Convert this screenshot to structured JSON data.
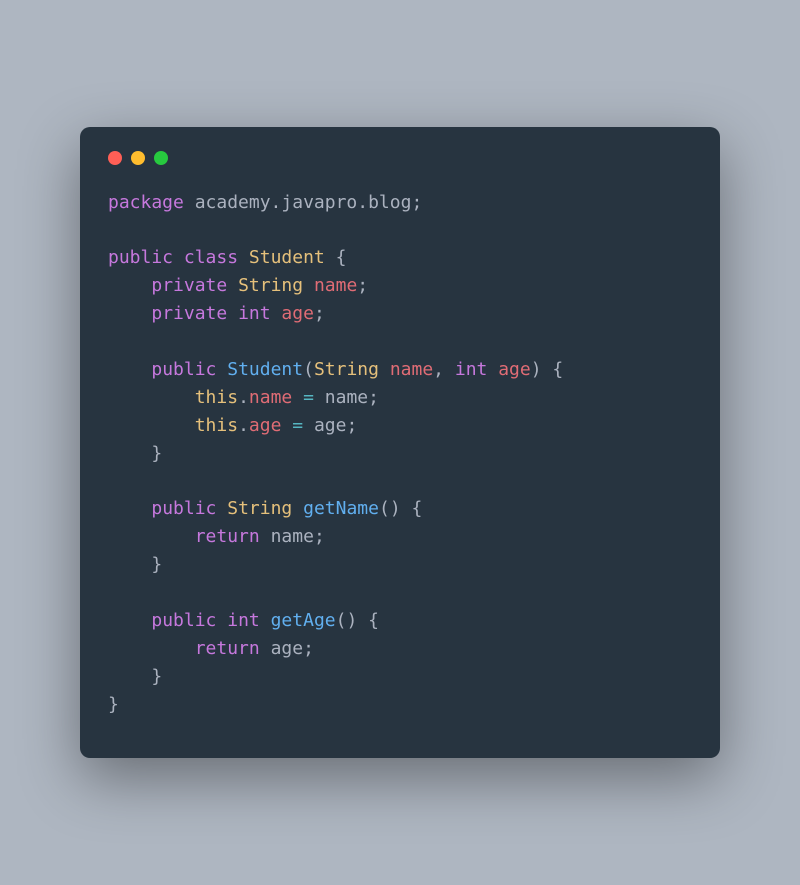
{
  "window": {
    "dot_colors": {
      "red": "#ff5f56",
      "yellow": "#ffbd2e",
      "green": "#27c93f"
    }
  },
  "code": {
    "tokens": [
      [
        [
          "kw",
          "package"
        ],
        [
          "plain",
          " "
        ],
        [
          "pkg",
          "academy.javapro.blog"
        ],
        [
          "punct",
          ";"
        ]
      ],
      [
        [
          "plain",
          ""
        ]
      ],
      [
        [
          "kw",
          "public"
        ],
        [
          "plain",
          " "
        ],
        [
          "kw",
          "class"
        ],
        [
          "plain",
          " "
        ],
        [
          "type",
          "Student"
        ],
        [
          "plain",
          " "
        ],
        [
          "punct",
          "{"
        ]
      ],
      [
        [
          "plain",
          "    "
        ],
        [
          "kw",
          "private"
        ],
        [
          "plain",
          " "
        ],
        [
          "type",
          "String"
        ],
        [
          "plain",
          " "
        ],
        [
          "ident",
          "name"
        ],
        [
          "punct",
          ";"
        ]
      ],
      [
        [
          "plain",
          "    "
        ],
        [
          "kw",
          "private"
        ],
        [
          "plain",
          " "
        ],
        [
          "kw",
          "int"
        ],
        [
          "plain",
          " "
        ],
        [
          "ident",
          "age"
        ],
        [
          "punct",
          ";"
        ]
      ],
      [
        [
          "plain",
          ""
        ]
      ],
      [
        [
          "plain",
          "    "
        ],
        [
          "kw",
          "public"
        ],
        [
          "plain",
          " "
        ],
        [
          "fn",
          "Student"
        ],
        [
          "punct",
          "("
        ],
        [
          "type",
          "String"
        ],
        [
          "plain",
          " "
        ],
        [
          "ident",
          "name"
        ],
        [
          "punct",
          ","
        ],
        [
          "plain",
          " "
        ],
        [
          "kw",
          "int"
        ],
        [
          "plain",
          " "
        ],
        [
          "ident",
          "age"
        ],
        [
          "punct",
          ")"
        ],
        [
          "plain",
          " "
        ],
        [
          "punct",
          "{"
        ]
      ],
      [
        [
          "plain",
          "        "
        ],
        [
          "thiskw",
          "this"
        ],
        [
          "punct",
          "."
        ],
        [
          "ident",
          "name"
        ],
        [
          "plain",
          " "
        ],
        [
          "op",
          "="
        ],
        [
          "plain",
          " "
        ],
        [
          "plain",
          "name"
        ],
        [
          "punct",
          ";"
        ]
      ],
      [
        [
          "plain",
          "        "
        ],
        [
          "thiskw",
          "this"
        ],
        [
          "punct",
          "."
        ],
        [
          "ident",
          "age"
        ],
        [
          "plain",
          " "
        ],
        [
          "op",
          "="
        ],
        [
          "plain",
          " "
        ],
        [
          "plain",
          "age"
        ],
        [
          "punct",
          ";"
        ]
      ],
      [
        [
          "plain",
          "    "
        ],
        [
          "punct",
          "}"
        ]
      ],
      [
        [
          "plain",
          ""
        ]
      ],
      [
        [
          "plain",
          "    "
        ],
        [
          "kw",
          "public"
        ],
        [
          "plain",
          " "
        ],
        [
          "type",
          "String"
        ],
        [
          "plain",
          " "
        ],
        [
          "fn",
          "getName"
        ],
        [
          "punct",
          "("
        ],
        [
          "punct",
          ")"
        ],
        [
          "plain",
          " "
        ],
        [
          "punct",
          "{"
        ]
      ],
      [
        [
          "plain",
          "        "
        ],
        [
          "kw",
          "return"
        ],
        [
          "plain",
          " "
        ],
        [
          "plain",
          "name"
        ],
        [
          "punct",
          ";"
        ]
      ],
      [
        [
          "plain",
          "    "
        ],
        [
          "punct",
          "}"
        ]
      ],
      [
        [
          "plain",
          ""
        ]
      ],
      [
        [
          "plain",
          "    "
        ],
        [
          "kw",
          "public"
        ],
        [
          "plain",
          " "
        ],
        [
          "kw",
          "int"
        ],
        [
          "plain",
          " "
        ],
        [
          "fn",
          "getAge"
        ],
        [
          "punct",
          "("
        ],
        [
          "punct",
          ")"
        ],
        [
          "plain",
          " "
        ],
        [
          "punct",
          "{"
        ]
      ],
      [
        [
          "plain",
          "        "
        ],
        [
          "kw",
          "return"
        ],
        [
          "plain",
          " "
        ],
        [
          "plain",
          "age"
        ],
        [
          "punct",
          ";"
        ]
      ],
      [
        [
          "plain",
          "    "
        ],
        [
          "punct",
          "}"
        ]
      ],
      [
        [
          "punct",
          "}"
        ]
      ]
    ]
  }
}
